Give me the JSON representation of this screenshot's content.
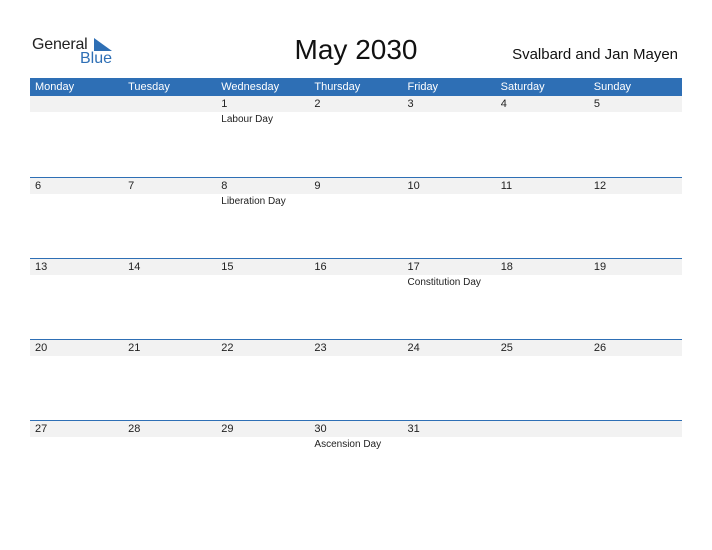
{
  "logo": {
    "general": "General",
    "blue": "Blue",
    "icon": "triangle-flag-icon"
  },
  "title": "May 2030",
  "region": "Svalbard and Jan Mayen",
  "colors": {
    "accent": "#2e6fb5",
    "band": "#f2f2f2"
  },
  "days": [
    "Monday",
    "Tuesday",
    "Wednesday",
    "Thursday",
    "Friday",
    "Saturday",
    "Sunday"
  ],
  "weeks": [
    [
      {
        "d": ""
      },
      {
        "d": ""
      },
      {
        "d": "1",
        "h": "Labour Day"
      },
      {
        "d": "2"
      },
      {
        "d": "3"
      },
      {
        "d": "4"
      },
      {
        "d": "5"
      }
    ],
    [
      {
        "d": "6"
      },
      {
        "d": "7"
      },
      {
        "d": "8",
        "h": "Liberation Day"
      },
      {
        "d": "9"
      },
      {
        "d": "10"
      },
      {
        "d": "11"
      },
      {
        "d": "12"
      }
    ],
    [
      {
        "d": "13"
      },
      {
        "d": "14"
      },
      {
        "d": "15"
      },
      {
        "d": "16"
      },
      {
        "d": "17",
        "h": "Constitution Day"
      },
      {
        "d": "18"
      },
      {
        "d": "19"
      }
    ],
    [
      {
        "d": "20"
      },
      {
        "d": "21"
      },
      {
        "d": "22"
      },
      {
        "d": "23"
      },
      {
        "d": "24"
      },
      {
        "d": "25"
      },
      {
        "d": "26"
      }
    ],
    [
      {
        "d": "27"
      },
      {
        "d": "28"
      },
      {
        "d": "29"
      },
      {
        "d": "30",
        "h": "Ascension Day"
      },
      {
        "d": "31"
      },
      {
        "d": ""
      },
      {
        "d": ""
      }
    ]
  ]
}
